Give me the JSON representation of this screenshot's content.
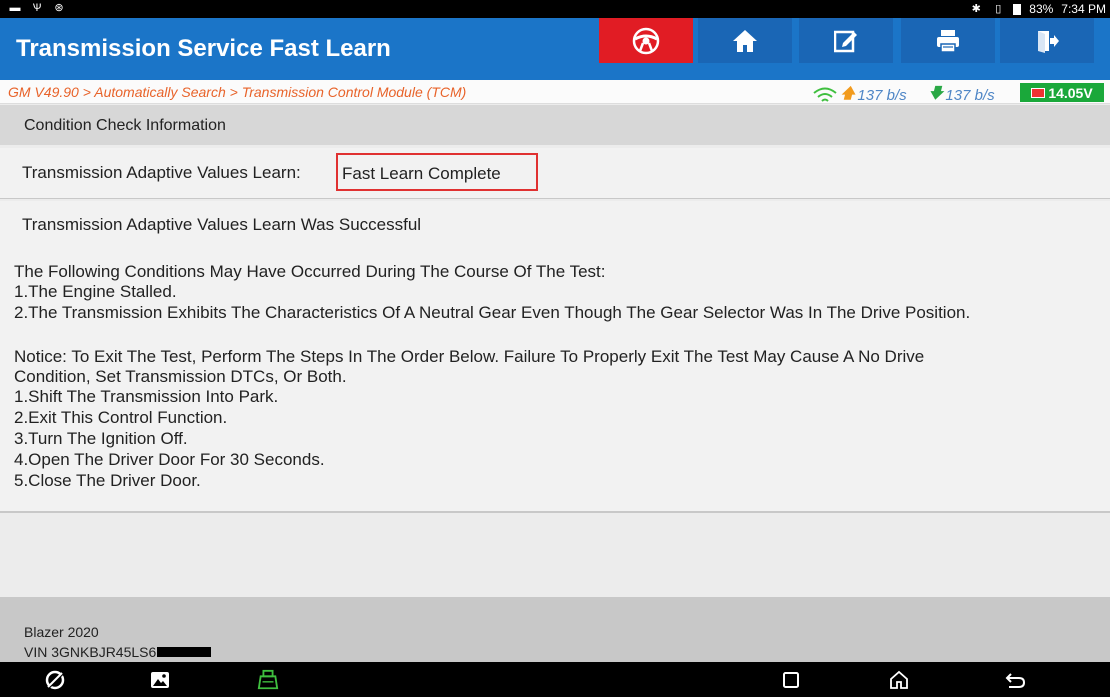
{
  "status_bar": {
    "left_icons": [
      "image-icon",
      "usb-icon",
      "vci-status-icon"
    ],
    "battery_text": "83%",
    "time": "7:34 PM"
  },
  "header": {
    "title": "Transmission Service Fast Learn",
    "buttons": [
      "steering-wheel-icon",
      "home-icon",
      "edit-icon",
      "print-icon",
      "exit-icon"
    ]
  },
  "breadcrumb": {
    "path": "GM V49.90 > Automatically Search > Transmission Control Module (TCM)",
    "upload_speed": "137 b/s",
    "download_speed": "137 b/s",
    "voltage": "14.05V",
    "colors": {
      "path": "#e8632a",
      "speed": "#4f86c6",
      "voltage_bg": "#1aa83a"
    }
  },
  "section": {
    "title": "Condition Check Information"
  },
  "status_row": {
    "label": "Transmission Adaptive Values Learn:",
    "value": "Fast Learn Complete",
    "highlight_color": "#e03131"
  },
  "message": {
    "lines": [
      "Transmission Adaptive Values Learn Was Successful",
      "The Following Conditions May Have Occurred During The Course Of The Test:",
      "1.The Engine Stalled.",
      "2.The Transmission Exhibits The Characteristics Of A Neutral Gear Even Though The Gear Selector Was In The Drive Position.",
      "Notice: To Exit The Test, Perform The Steps In The Order Below. Failure To Properly Exit The Test May Cause A No Drive",
      "Condition, Set Transmission DTCs, Or Both.",
      "1.Shift The Transmission Into Park.",
      "2.Exit This Control Function.",
      "3.Turn The Ignition Off.",
      "4.Open The Driver Door For 30 Seconds.",
      "5.Close The Driver Door."
    ]
  },
  "footer": {
    "vehicle": "Blazer 2020",
    "vin": "VIN 3GNKBJR45LS6"
  },
  "nav": [
    "browser-icon",
    "gallery-icon",
    "vci-icon",
    "recents-icon",
    "home-nav-icon",
    "back-icon"
  ],
  "theme": {
    "title_bar": "#1b75c8",
    "button": "#1a66b5",
    "alert_button": "#e11c24"
  }
}
